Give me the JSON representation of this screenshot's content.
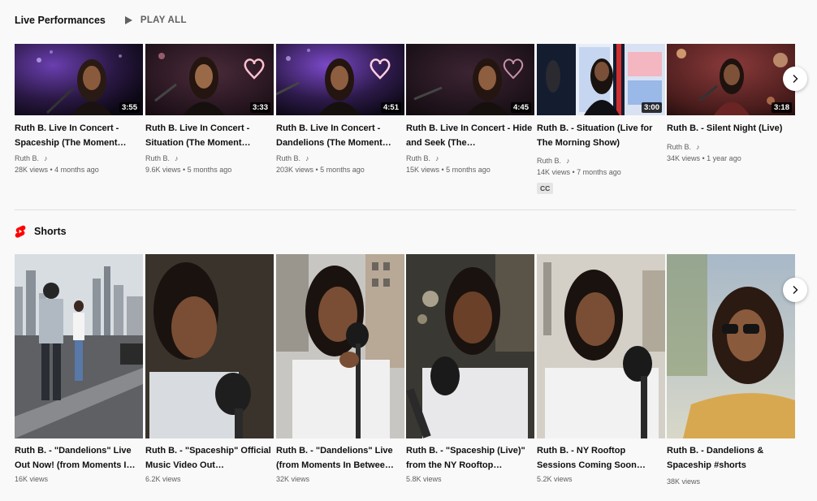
{
  "live": {
    "title": "Live Performances",
    "play_all": "PLAY ALL",
    "videos": [
      {
        "title": "Ruth B. Live In Concert - Spaceship (The Moment…",
        "duration": "3:55",
        "channel": "Ruth B.",
        "meta": "28K views • 4 months ago"
      },
      {
        "title": "Ruth B. Live In Concert - Situation (The Moment…",
        "duration": "3:33",
        "channel": "Ruth B.",
        "meta": "9.6K views • 5 months ago"
      },
      {
        "title": "Ruth B. Live In Concert - Dandelions (The Moment…",
        "duration": "4:51",
        "channel": "Ruth B.",
        "meta": "203K views • 5 months ago"
      },
      {
        "title": "Ruth B. Live In Concert - Hide and Seek (The…",
        "duration": "4:45",
        "channel": "Ruth B.",
        "meta": "15K views • 5 months ago"
      },
      {
        "title": "Ruth B. - Situation (Live for The Morning Show)",
        "duration": "3:00",
        "channel": "Ruth B.",
        "meta": "14K views • 7 months ago",
        "badge": "CC"
      },
      {
        "title": "Ruth B. - Silent Night (Live)",
        "duration": "3:18",
        "channel": "Ruth B.",
        "meta": "34K views • 1 year ago"
      }
    ]
  },
  "shorts": {
    "title": "Shorts",
    "items": [
      {
        "title": "Ruth B. - \"Dandelions\" Live Out Now! (from Moments I…",
        "views": "16K views"
      },
      {
        "title": "Ruth B. - \"Spaceship\" Official Music Video Out…",
        "views": "6.2K views"
      },
      {
        "title": "Ruth B. - \"Dandelions\" Live (from Moments In Betwee…",
        "views": "32K views"
      },
      {
        "title": "Ruth B. - \"Spaceship (Live)\" from the NY Rooftop…",
        "views": "5.8K views"
      },
      {
        "title": "Ruth B. - NY Rooftop Sessions Coming Soon…",
        "views": "5.2K views"
      },
      {
        "title": "Ruth B. - Dandelions & Spaceship #shorts",
        "views": "38K views"
      }
    ]
  },
  "icons": {
    "play": "play-icon",
    "next": "chevron-right-icon",
    "shorts": "shorts-logo-icon",
    "music": "music-note-icon"
  },
  "colors": {
    "shorts_red": "#ff0000",
    "secondary_text": "#606060"
  }
}
